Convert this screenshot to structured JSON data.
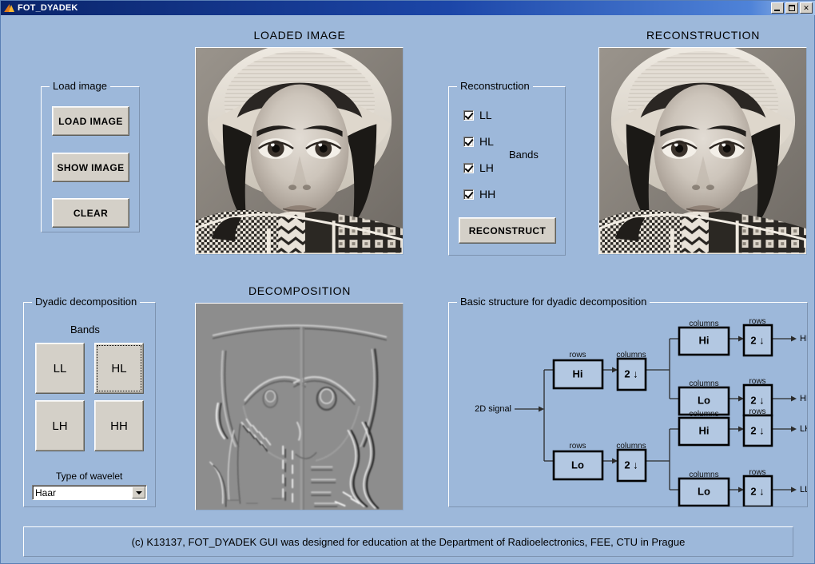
{
  "window": {
    "title": "FOT_DYADEK",
    "icon": "matlab-icon",
    "minimize_label": "_",
    "maximize_label": "□",
    "close_label": "✕"
  },
  "colors": {
    "background": "#9db8da",
    "button_face": "#d4d0c8",
    "panel_border": "#ffffff",
    "text": "#000000",
    "titlebar_start": "#0a246a",
    "titlebar_end": "#a6c4ea"
  },
  "headings": {
    "loaded_image": "LOADED IMAGE",
    "reconstruction": "RECONSTRUCTION",
    "decomposition": "DECOMPOSITION"
  },
  "load_panel": {
    "title": "Load image",
    "buttons": [
      {
        "label": "LOAD IMAGE",
        "name": "load-image-button"
      },
      {
        "label": "SHOW IMAGE",
        "name": "show-image-button"
      },
      {
        "label": "CLEAR",
        "name": "clear-button"
      }
    ]
  },
  "reconstruction_panel": {
    "title": "Reconstruction",
    "bands_label": "Bands",
    "checkboxes": [
      {
        "label": "LL",
        "checked": true
      },
      {
        "label": "HL",
        "checked": true
      },
      {
        "label": "LH",
        "checked": true
      },
      {
        "label": "HH",
        "checked": true
      }
    ],
    "reconstruct_button": "RECONSTRUCT"
  },
  "dyadic_panel": {
    "title": "Dyadic decomposition",
    "bands_label": "Bands",
    "bands": [
      {
        "label": "LL",
        "focused": false
      },
      {
        "label": "HL",
        "focused": true
      },
      {
        "label": "LH",
        "focused": false
      },
      {
        "label": "HH",
        "focused": false
      }
    ],
    "wavelet_label": "Type of wavelet",
    "wavelet_selected": "Haar",
    "wavelet_options": [
      "Haar"
    ]
  },
  "structure_panel": {
    "title": "Basic structure for dyadic decomposition",
    "input_label": "2D signal",
    "caption_rows": "rows",
    "caption_columns": "columns",
    "downsample_label": "2 ↓",
    "blocks": {
      "stage1_hi": "Hi",
      "stage1_lo": "Lo",
      "stage2_hi": "Hi",
      "stage2_lo": "Lo"
    },
    "outputs": [
      "HH",
      "HL",
      "LH",
      "LL"
    ]
  },
  "footer": {
    "text": "(c) K13137, FOT_DYADEK GUI was designed for education at the Department of Radioelectronics, FEE, CTU in Prague"
  },
  "images": {
    "loaded": "barbara-portrait-grayscale",
    "reconstruction": "barbara-portrait-grayscale",
    "decomposition": "hl-subband-horizontal-detail"
  }
}
